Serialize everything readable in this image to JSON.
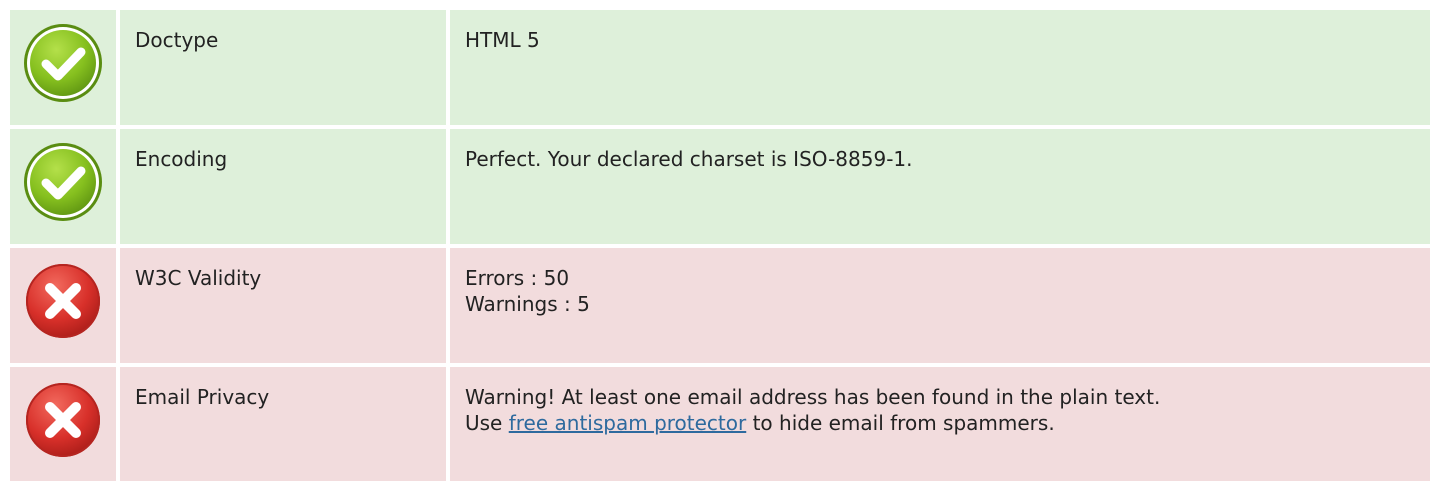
{
  "rows": [
    {
      "status": "pass",
      "icon": "check-icon",
      "label": "Doctype",
      "value": "HTML 5"
    },
    {
      "status": "pass",
      "icon": "check-icon",
      "label": "Encoding",
      "value": "Perfect. Your declared charset is ISO-8859-1."
    },
    {
      "status": "fail",
      "icon": "cross-icon",
      "label": "W3C Validity",
      "value_lines": [
        "Errors : 50",
        "Warnings : 5"
      ]
    },
    {
      "status": "fail",
      "icon": "cross-icon",
      "label": "Email Privacy",
      "value_line1": "Warning! At least one email address has been found in the plain text.",
      "value_line2_prefix": "Use ",
      "value_line2_link": "free antispam protector",
      "value_line2_suffix": " to hide email from spammers."
    }
  ],
  "colors": {
    "pass_bg": "#def0da",
    "fail_bg": "#f2dcdd",
    "link": "#2e6a9e",
    "check_green": "#7fba1e",
    "cross_red": "#d8302a"
  }
}
